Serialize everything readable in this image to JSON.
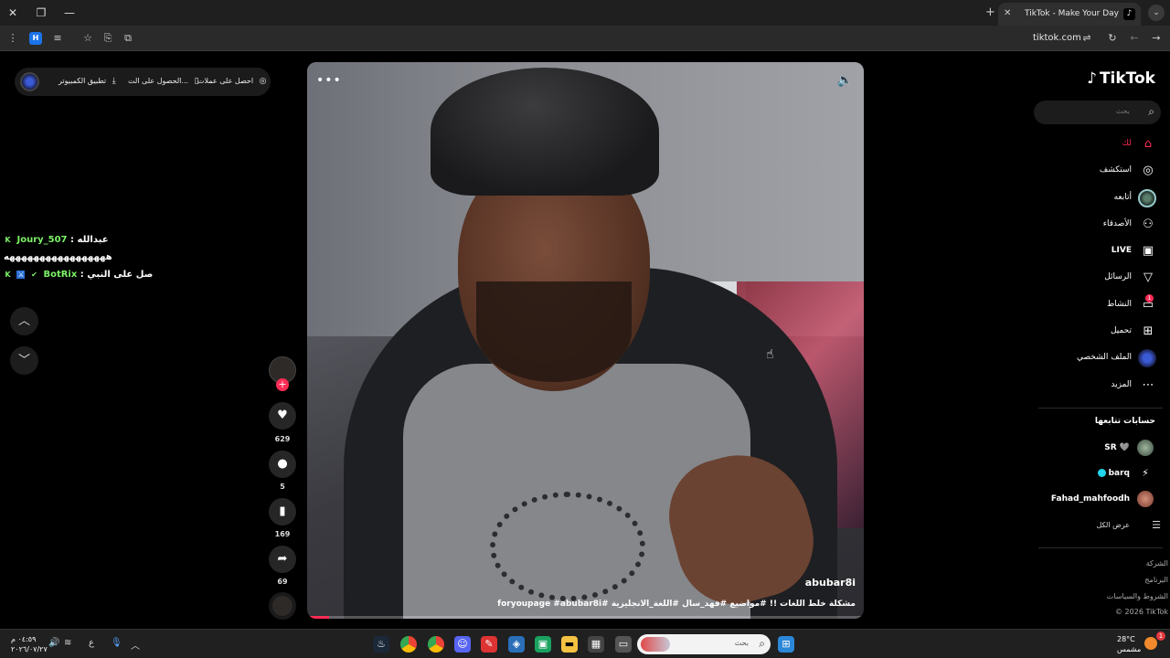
{
  "browser": {
    "tab_title": "TikTok - Make Your Day",
    "tab_favicon": "tiktok-icon",
    "url": "tiktok.com",
    "profile_letter": "H"
  },
  "top_pill": {
    "coins_label": "احصل على عملات",
    "app_label": "الحصول على الت...",
    "desktop_label": "تطبيق الكمبيوتر"
  },
  "chat": [
    {
      "user": "Joury_507",
      "sep": " : ",
      "message": "عبدالله"
    },
    {
      "user": "",
      "sep": "",
      "message": "هههههههههههههههههه"
    },
    {
      "user": "BotRix",
      "sep": " : ",
      "message": "صل على النبي"
    }
  ],
  "video": {
    "author": "abubar8i",
    "caption": "مشكلة خلط اللغات !! #مواضيع #فهد_سال #اللغة_الانجليزية #foryoupage #abubar8i",
    "progress": 0.04
  },
  "actions": {
    "likes": "629",
    "comments": "5",
    "saves": "169",
    "shares": "69"
  },
  "sidebar": {
    "logo": "TikTok",
    "search_placeholder": "بحث",
    "nav": [
      {
        "label": "لك",
        "icon": "home-icon",
        "active": true
      },
      {
        "label": "استكشف",
        "icon": "compass-icon"
      },
      {
        "label": "أتابعه",
        "icon": "following-avatar-icon"
      },
      {
        "label": "الأصدقاء",
        "icon": "friends-icon"
      },
      {
        "label": "LIVE",
        "icon": "live-icon"
      },
      {
        "label": "الرسائل",
        "icon": "messages-icon"
      },
      {
        "label": "النشاط",
        "icon": "activity-icon",
        "badge": "1"
      },
      {
        "label": "تحميل",
        "icon": "upload-icon"
      },
      {
        "label": "الملف الشخصي",
        "icon": "profile-avatar-icon"
      },
      {
        "label": "المزيد",
        "icon": "more-icon"
      }
    ],
    "following_title": "حسابات تتابعها",
    "following": [
      {
        "name": "SR 🩶"
      },
      {
        "name": "barq"
      },
      {
        "name": "Fahad_mahfoodh"
      }
    ],
    "see_all": "عرض الكل",
    "footer": [
      "الشركة",
      "البرنامج",
      "الشروط والسياسات",
      "© 2026 TikTok"
    ]
  },
  "taskbar": {
    "search_placeholder": "بحث",
    "time": "٠٤:٥٩ م",
    "date": "٢٠٢٦/٠٧/٢٧",
    "lang": "ع",
    "temperature": "28°C",
    "weather": "مشمس",
    "weather_badge": "1"
  },
  "colors": {
    "accent": "#fe2c55",
    "chat_user": "#7cf266"
  }
}
